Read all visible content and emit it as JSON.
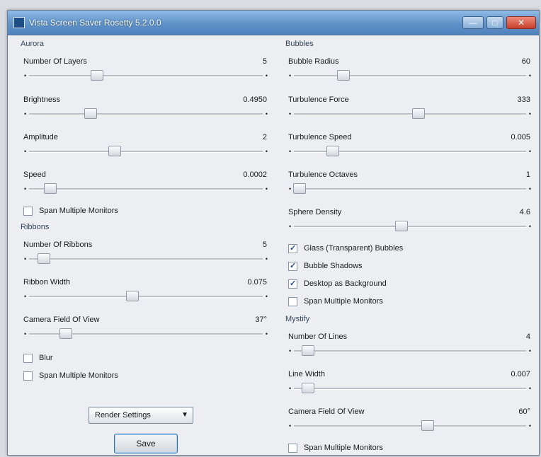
{
  "window": {
    "title": "Vista Screen Saver Rosetty 5.2.0.0"
  },
  "icons": {
    "app": "app-icon",
    "minimize": "minimize-icon",
    "maximize": "maximize-icon",
    "close": "close-icon",
    "dropdown": "chevron-down-icon"
  },
  "caption": {
    "minimize_glyph": "—",
    "maximize_glyph": "□",
    "close_glyph": "✕"
  },
  "slider_tick": "•",
  "checkmark": "✓",
  "aurora": {
    "title": "Aurora",
    "layers": {
      "label": "Number Of Layers",
      "value": "5",
      "level": 0.28
    },
    "brightness": {
      "label": "Brightness",
      "value": "0.4950",
      "level": 0.25
    },
    "amplitude": {
      "label": "Amplitude",
      "value": "2",
      "level": 0.36
    },
    "speed": {
      "label": "Speed",
      "value": "0.0002",
      "level": 0.07
    },
    "span": {
      "label": "Span Multiple Monitors",
      "checked": false
    }
  },
  "ribbons": {
    "title": "Ribbons",
    "count": {
      "label": "Number Of Ribbons",
      "value": "5",
      "level": 0.04
    },
    "width": {
      "label": "Ribbon Width",
      "value": "0.075",
      "level": 0.44
    },
    "fov": {
      "label": "Camera Field Of View",
      "value": "37°",
      "level": 0.14
    },
    "blur": {
      "label": "Blur",
      "checked": false
    },
    "span": {
      "label": "Span Multiple Monitors",
      "checked": false
    }
  },
  "render_select": {
    "value": "Render Settings"
  },
  "save_label": "Save",
  "bubbles": {
    "title": "Bubbles",
    "radius": {
      "label": "Bubble Radius",
      "value": "60",
      "level": 0.2
    },
    "turb_force": {
      "label": "Turbulence Force",
      "value": "333",
      "level": 0.54
    },
    "turb_speed": {
      "label": "Turbulence Speed",
      "value": "0.005",
      "level": 0.15
    },
    "turb_octaves": {
      "label": "Turbulence Octaves",
      "value": "1",
      "level": 0.0
    },
    "sphere_density": {
      "label": "Sphere Density",
      "value": "4.6",
      "level": 0.46
    },
    "glass": {
      "label": "Glass (Transparent) Bubbles",
      "checked": true
    },
    "shadows": {
      "label": "Bubble Shadows",
      "checked": true
    },
    "desktop_bg": {
      "label": "Desktop as Background",
      "checked": true
    },
    "span": {
      "label": "Span Multiple Monitors",
      "checked": false
    }
  },
  "mystify": {
    "title": "Mystify",
    "lines": {
      "label": "Number Of Lines",
      "value": "4",
      "level": 0.04
    },
    "width": {
      "label": "Line Width",
      "value": "0.007",
      "level": 0.04
    },
    "fov": {
      "label": "Camera Field Of View",
      "value": "60°",
      "level": 0.58
    },
    "span": {
      "label": "Span Multiple Monitors",
      "checked": false
    }
  }
}
